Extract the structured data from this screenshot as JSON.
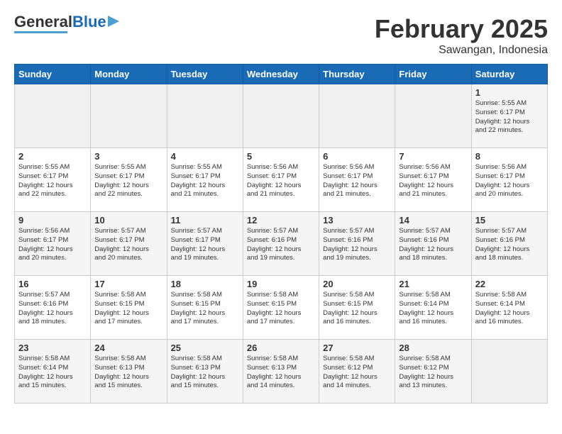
{
  "header": {
    "logo_general": "General",
    "logo_blue": "Blue",
    "title": "February 2025",
    "subtitle": "Sawangan, Indonesia"
  },
  "days_of_week": [
    "Sunday",
    "Monday",
    "Tuesday",
    "Wednesday",
    "Thursday",
    "Friday",
    "Saturday"
  ],
  "weeks": [
    [
      {
        "day": "",
        "info": ""
      },
      {
        "day": "",
        "info": ""
      },
      {
        "day": "",
        "info": ""
      },
      {
        "day": "",
        "info": ""
      },
      {
        "day": "",
        "info": ""
      },
      {
        "day": "",
        "info": ""
      },
      {
        "day": "1",
        "info": "Sunrise: 5:55 AM\nSunset: 6:17 PM\nDaylight: 12 hours\nand 22 minutes."
      }
    ],
    [
      {
        "day": "2",
        "info": "Sunrise: 5:55 AM\nSunset: 6:17 PM\nDaylight: 12 hours\nand 22 minutes."
      },
      {
        "day": "3",
        "info": "Sunrise: 5:55 AM\nSunset: 6:17 PM\nDaylight: 12 hours\nand 22 minutes."
      },
      {
        "day": "4",
        "info": "Sunrise: 5:55 AM\nSunset: 6:17 PM\nDaylight: 12 hours\nand 21 minutes."
      },
      {
        "day": "5",
        "info": "Sunrise: 5:56 AM\nSunset: 6:17 PM\nDaylight: 12 hours\nand 21 minutes."
      },
      {
        "day": "6",
        "info": "Sunrise: 5:56 AM\nSunset: 6:17 PM\nDaylight: 12 hours\nand 21 minutes."
      },
      {
        "day": "7",
        "info": "Sunrise: 5:56 AM\nSunset: 6:17 PM\nDaylight: 12 hours\nand 21 minutes."
      },
      {
        "day": "8",
        "info": "Sunrise: 5:56 AM\nSunset: 6:17 PM\nDaylight: 12 hours\nand 20 minutes."
      }
    ],
    [
      {
        "day": "9",
        "info": "Sunrise: 5:56 AM\nSunset: 6:17 PM\nDaylight: 12 hours\nand 20 minutes."
      },
      {
        "day": "10",
        "info": "Sunrise: 5:57 AM\nSunset: 6:17 PM\nDaylight: 12 hours\nand 20 minutes."
      },
      {
        "day": "11",
        "info": "Sunrise: 5:57 AM\nSunset: 6:17 PM\nDaylight: 12 hours\nand 19 minutes."
      },
      {
        "day": "12",
        "info": "Sunrise: 5:57 AM\nSunset: 6:16 PM\nDaylight: 12 hours\nand 19 minutes."
      },
      {
        "day": "13",
        "info": "Sunrise: 5:57 AM\nSunset: 6:16 PM\nDaylight: 12 hours\nand 19 minutes."
      },
      {
        "day": "14",
        "info": "Sunrise: 5:57 AM\nSunset: 6:16 PM\nDaylight: 12 hours\nand 18 minutes."
      },
      {
        "day": "15",
        "info": "Sunrise: 5:57 AM\nSunset: 6:16 PM\nDaylight: 12 hours\nand 18 minutes."
      }
    ],
    [
      {
        "day": "16",
        "info": "Sunrise: 5:57 AM\nSunset: 6:16 PM\nDaylight: 12 hours\nand 18 minutes."
      },
      {
        "day": "17",
        "info": "Sunrise: 5:58 AM\nSunset: 6:15 PM\nDaylight: 12 hours\nand 17 minutes."
      },
      {
        "day": "18",
        "info": "Sunrise: 5:58 AM\nSunset: 6:15 PM\nDaylight: 12 hours\nand 17 minutes."
      },
      {
        "day": "19",
        "info": "Sunrise: 5:58 AM\nSunset: 6:15 PM\nDaylight: 12 hours\nand 17 minutes."
      },
      {
        "day": "20",
        "info": "Sunrise: 5:58 AM\nSunset: 6:15 PM\nDaylight: 12 hours\nand 16 minutes."
      },
      {
        "day": "21",
        "info": "Sunrise: 5:58 AM\nSunset: 6:14 PM\nDaylight: 12 hours\nand 16 minutes."
      },
      {
        "day": "22",
        "info": "Sunrise: 5:58 AM\nSunset: 6:14 PM\nDaylight: 12 hours\nand 16 minutes."
      }
    ],
    [
      {
        "day": "23",
        "info": "Sunrise: 5:58 AM\nSunset: 6:14 PM\nDaylight: 12 hours\nand 15 minutes."
      },
      {
        "day": "24",
        "info": "Sunrise: 5:58 AM\nSunset: 6:13 PM\nDaylight: 12 hours\nand 15 minutes."
      },
      {
        "day": "25",
        "info": "Sunrise: 5:58 AM\nSunset: 6:13 PM\nDaylight: 12 hours\nand 15 minutes."
      },
      {
        "day": "26",
        "info": "Sunrise: 5:58 AM\nSunset: 6:13 PM\nDaylight: 12 hours\nand 14 minutes."
      },
      {
        "day": "27",
        "info": "Sunrise: 5:58 AM\nSunset: 6:12 PM\nDaylight: 12 hours\nand 14 minutes."
      },
      {
        "day": "28",
        "info": "Sunrise: 5:58 AM\nSunset: 6:12 PM\nDaylight: 12 hours\nand 13 minutes."
      },
      {
        "day": "",
        "info": ""
      }
    ]
  ]
}
